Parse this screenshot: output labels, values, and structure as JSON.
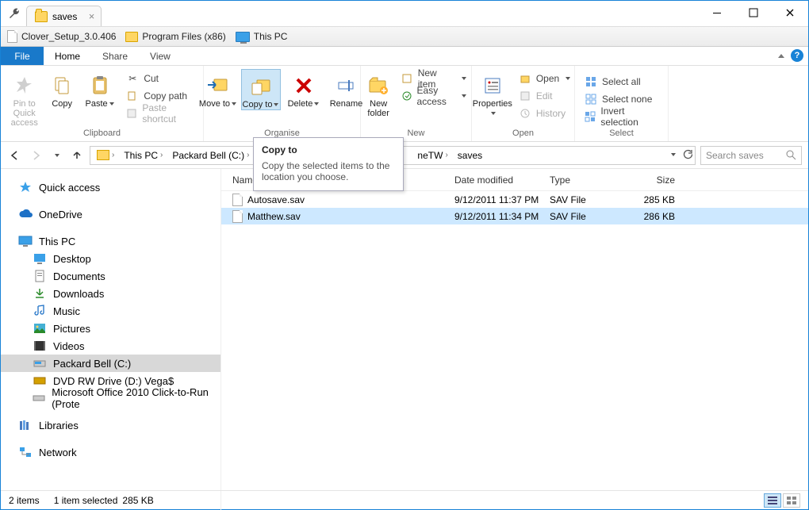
{
  "tab": {
    "title": "saves"
  },
  "bookmarks": {
    "b1": "Clover_Setup_3.0.406",
    "b2": "Program Files (x86)",
    "b3": "This PC"
  },
  "menu": {
    "file": "File",
    "home": "Home",
    "share": "Share",
    "view": "View"
  },
  "ribbon": {
    "pinqa": "Pin to Quick access",
    "copy": "Copy",
    "paste": "Paste",
    "cut": "Cut",
    "copypath": "Copy path",
    "pastesc": "Paste shortcut",
    "clipboard": "Clipboard",
    "moveto": "Move to",
    "copyto": "Copy to",
    "delete": "Delete",
    "rename": "Rename",
    "organise": "Organise",
    "newfolder": "New folder",
    "newitem": "New item",
    "easyaccess": "Easy access",
    "new": "New",
    "properties": "Properties",
    "open": "Open",
    "edit": "Edit",
    "history": "History",
    "openg": "Open",
    "selall": "Select all",
    "selnone": "Select none",
    "invsel": "Invert selection",
    "selectg": "Select"
  },
  "tooltip": {
    "title": "Copy to",
    "body": "Copy the selected items to the location you choose."
  },
  "breadcrumb": {
    "thispc": "This PC",
    "drive": "Packard Bell (C:)",
    "p4": "neTW",
    "p5": "saves"
  },
  "search": {
    "placeholder": "Search saves"
  },
  "cols": {
    "name": "Name",
    "date": "Date modified",
    "type": "Type",
    "size": "Size"
  },
  "rows": [
    {
      "name": "Autosave.sav",
      "date": "9/12/2011 11:37 PM",
      "type": "SAV File",
      "size": "285 KB",
      "sel": false
    },
    {
      "name": "Matthew.sav",
      "date": "9/12/2011 11:34 PM",
      "type": "SAV File",
      "size": "286 KB",
      "sel": true
    }
  ],
  "nav": {
    "quick": "Quick access",
    "onedrive": "OneDrive",
    "thispc": "This PC",
    "desktop": "Desktop",
    "documents": "Documents",
    "downloads": "Downloads",
    "music": "Music",
    "pictures": "Pictures",
    "videos": "Videos",
    "drive": "Packard Bell (C:)",
    "dvd": "DVD RW Drive (D:) Vega$",
    "office": "Microsoft Office 2010 Click-to-Run (Prote",
    "libraries": "Libraries",
    "network": "Network"
  },
  "status": {
    "items": "2 items",
    "sel": "1 item selected",
    "size": "285 KB"
  }
}
